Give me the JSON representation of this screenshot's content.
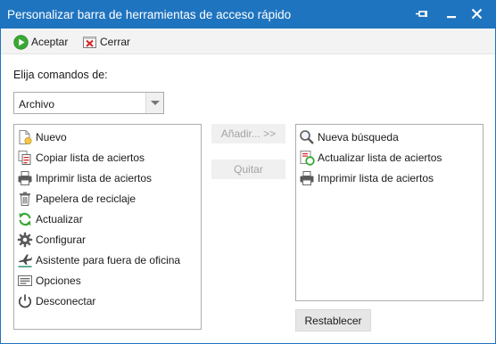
{
  "window": {
    "title": "Personalizar barra de herramientas de acceso rápido"
  },
  "titlebar_icons": [
    "pin-icon",
    "minimize-icon",
    "close-icon"
  ],
  "toolbar": {
    "accept_label": "Aceptar",
    "accept_icon": "green-play-icon",
    "close_label": "Cerrar",
    "close_icon": "red-x-icon"
  },
  "chooser": {
    "label": "Elija comandos de:",
    "selected": "Archivo"
  },
  "available_commands": [
    {
      "label": "Nuevo",
      "icon": "new-document-icon"
    },
    {
      "label": "Copiar lista de aciertos",
      "icon": "copy-list-icon"
    },
    {
      "label": "Imprimir lista de aciertos",
      "icon": "printer-icon"
    },
    {
      "label": "Papelera de reciclaje",
      "icon": "recycle-bin-icon"
    },
    {
      "label": "Actualizar",
      "icon": "refresh-icon"
    },
    {
      "label": "Configurar",
      "icon": "gear-icon"
    },
    {
      "label": "Asistente para fuera de oficina",
      "icon": "airplane-icon"
    },
    {
      "label": "Opciones",
      "icon": "options-icon"
    },
    {
      "label": "Desconectar",
      "icon": "power-icon"
    }
  ],
  "actions": {
    "add_label": "Añadir... >>",
    "remove_label": "Quitar",
    "reset_label": "Restablecer"
  },
  "toolbar_commands": [
    {
      "label": "Nueva búsqueda",
      "icon": "search-icon"
    },
    {
      "label": "Actualizar lista de aciertos",
      "icon": "refresh-list-icon"
    },
    {
      "label": "Imprimir lista de aciertos",
      "icon": "printer-icon"
    }
  ],
  "colors": {
    "titlebar": "#1f74bf",
    "accent_green": "#3aa835",
    "accent_red": "#d6262a"
  }
}
